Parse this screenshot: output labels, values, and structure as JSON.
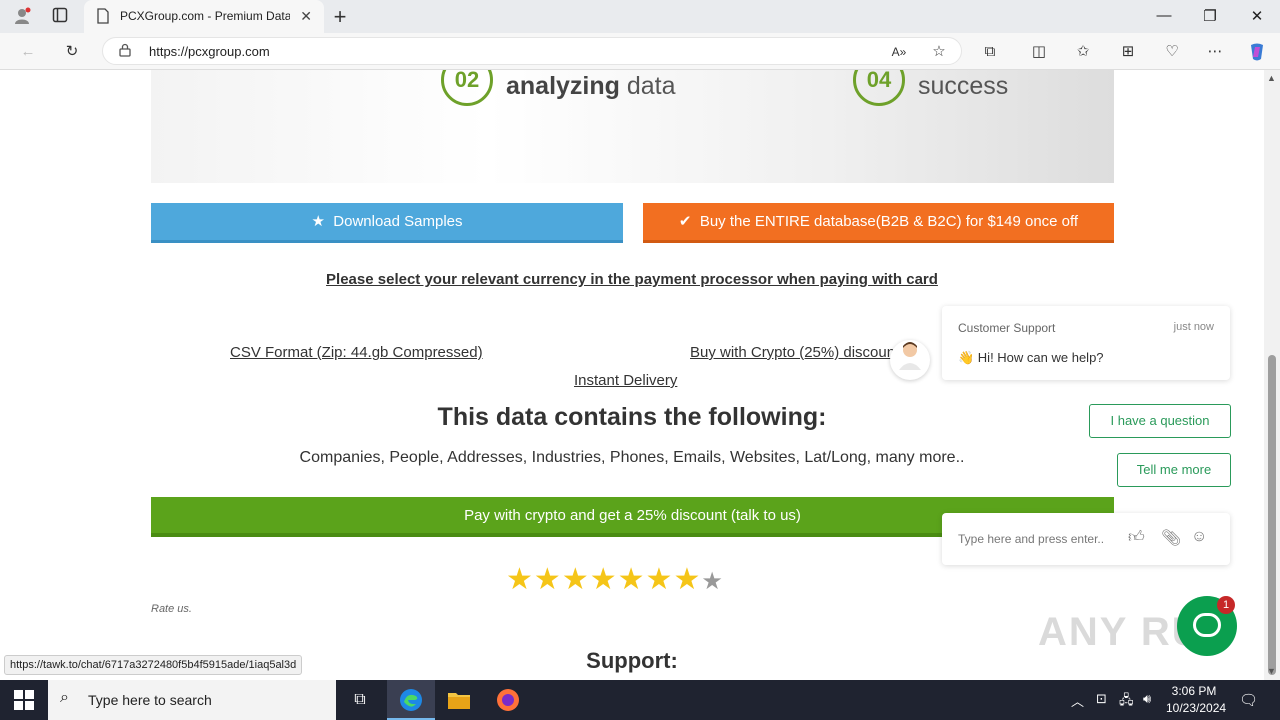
{
  "browser": {
    "tab_title": "PCXGroup.com - Premium Data",
    "tab_close": "✕",
    "new_tab": "+",
    "url": "https://pcxgroup.com",
    "window_controls": [
      "—",
      "❐",
      "✕"
    ]
  },
  "hero": {
    "steps": [
      {
        "number": "02",
        "bold": "analyzing",
        "text": " data"
      },
      {
        "number": "04",
        "bold": "",
        "text": "success"
      }
    ]
  },
  "buttons": {
    "download": "Download Samples",
    "buy": "Buy the ENTIRE database(B2B & B2C) for $149 once off"
  },
  "notice": "Please select your relevant currency in the payment processor when paying with card",
  "links": {
    "csv": "CSV Format (Zip: 44.gb Compressed)",
    "crypto": "Buy with Crypto (25%) discount",
    "instant": "Instant Delivery"
  },
  "contains": {
    "heading": "This data contains the following:",
    "list": "Companies, People, Addresses, Industries, Phones, Emails, Websites, Lat/Long, many more.."
  },
  "crypto_bar": "Pay with crypto and get a 25% discount (talk to us)",
  "rating": {
    "filled": 7,
    "total": 8,
    "label": "Rate us."
  },
  "support_heading": "Support:",
  "chat": {
    "sender": "Customer Support",
    "time": "just now",
    "message": "👋 Hi! How can we help?",
    "quick_replies": [
      "I have a question",
      "Tell me more"
    ],
    "input_placeholder": "Type here and press enter..",
    "badge_count": "1",
    "brand_color": "#0b9f4f"
  },
  "status_url": "https://tawk.to/chat/6717a3272480f5b4f5915ade/1iaq5al3d",
  "watermark": "ANY RUN",
  "taskbar": {
    "search_placeholder": "Type here to search",
    "time": "3:06 PM",
    "date": "10/23/2024"
  },
  "colors": {
    "download": "#4ea8dc",
    "buy": "#f26f21",
    "crypto_bar": "#5ba31b",
    "step_accent": "#6ea12a"
  }
}
